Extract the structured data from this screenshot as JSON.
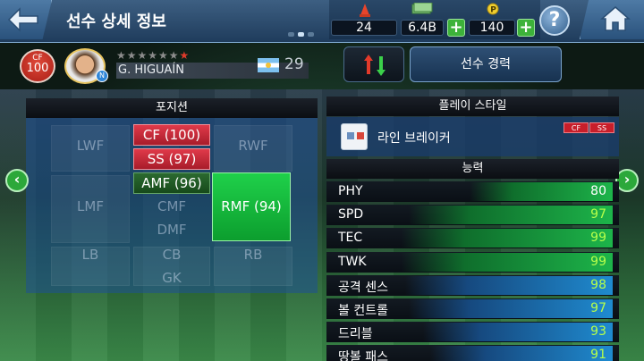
{
  "header": {
    "title": "선수 상세 정보",
    "resources": {
      "cones": "24",
      "money": "6.4B",
      "points": "140"
    },
    "plus_label": "+",
    "help_label": "?"
  },
  "player": {
    "position": "CF",
    "overall": "100",
    "name": "G. HIGUAÍN",
    "age": "29",
    "stars_total": 7,
    "club_badge": "N",
    "career_button": "선수 경력"
  },
  "positions": {
    "title": "포지션",
    "faded": [
      "LWF",
      "RWF",
      "LMF",
      "CMF",
      "DMF",
      "LB",
      "CB",
      "RB",
      "GK"
    ],
    "chips": {
      "cf": "CF (100)",
      "ss": "SS (97)",
      "amf": "AMF (96)",
      "rmf": "RMF (94)"
    }
  },
  "playstyle": {
    "title": "플레이 스타일",
    "name": "라인 브레이커",
    "tags": [
      "CF",
      "SS"
    ]
  },
  "abilities": {
    "title": "능력",
    "stats": [
      {
        "label": "PHY",
        "value": "80",
        "level": 0.8
      },
      {
        "label": "SPD",
        "value": "97",
        "level": 0.97
      },
      {
        "label": "TEC",
        "value": "99",
        "level": 0.99
      },
      {
        "label": "TWK",
        "value": "99",
        "level": 0.99
      },
      {
        "label": "공격 센스",
        "value": "98",
        "level": 0.98
      },
      {
        "label": "볼 컨트롤",
        "value": "97",
        "level": 0.97
      },
      {
        "label": "드리블",
        "value": "93",
        "level": 0.93
      },
      {
        "label": "땅볼 패스",
        "value": "91",
        "level": 0.91
      }
    ]
  },
  "colors": {
    "accent_green": "#1db54a",
    "accent_red": "#d22534",
    "header_blue": "#2a527c"
  }
}
